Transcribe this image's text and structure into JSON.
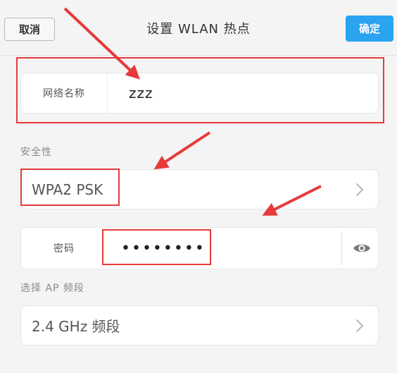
{
  "header": {
    "cancel_label": "取消",
    "title": "设置 WLAN 热点",
    "confirm_label": "确定"
  },
  "network_name": {
    "label": "网络名称",
    "value": "zzz"
  },
  "security": {
    "section_label": "安全性",
    "value": "WPA2 PSK"
  },
  "password": {
    "label": "密码",
    "value": "••••••••"
  },
  "ap_band": {
    "section_label": "选择 AP 频段",
    "value": "2.4 GHz 频段"
  },
  "icons": {
    "chevron": "chevron-right-icon",
    "eye": "eye-icon",
    "annotation": "red-arrow"
  },
  "colors": {
    "accent": "#2aa3f0",
    "annotation": "#e53a3a"
  }
}
